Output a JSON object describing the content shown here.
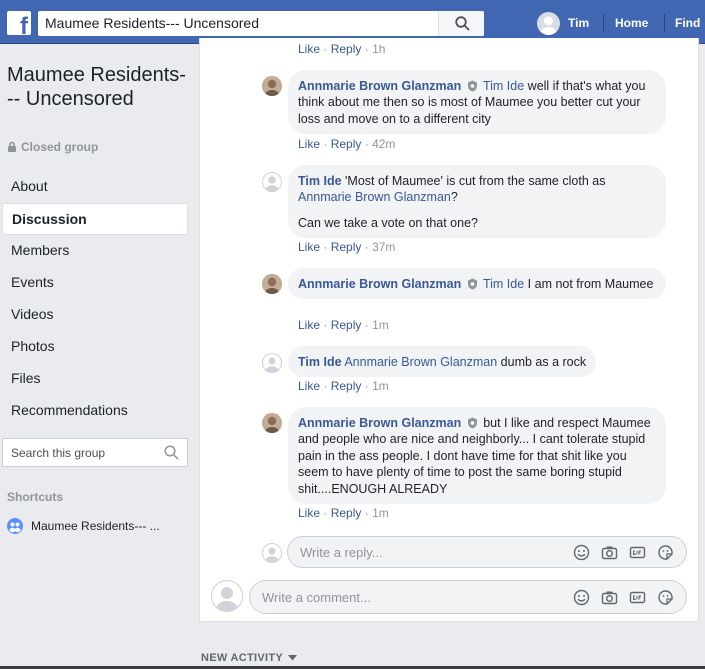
{
  "topbar": {
    "search_value": "Maumee Residents--- Uncensored",
    "user_name": "Tim",
    "nav": [
      "Home",
      "Find"
    ],
    "accent": "#4267b2"
  },
  "group": {
    "title": "Maumee Residents--- Uncensored",
    "privacy": "Closed group",
    "nav": [
      "About",
      "Discussion",
      "Members",
      "Events",
      "Videos",
      "Photos",
      "Files",
      "Recommendations"
    ],
    "active_nav": "Discussion",
    "search_placeholder": "Search this group",
    "shortcuts_heading": "Shortcuts",
    "shortcut_item": "Maumee Residents--- ..."
  },
  "feed": {
    "top_actions": {
      "like": "Like",
      "reply": "Reply",
      "time": "1h"
    },
    "comments": [
      {
        "author": "Annmarie Brown Glanzman",
        "mention": "Tim Ide",
        "text": "well if that's what you think about me then so is most of Maumee you better cut your loss and move on to a different city",
        "like": "Like",
        "reply": "Reply",
        "time": "42m"
      },
      {
        "author": "Tim Ide",
        "text_before": "'Most of Maumee' is cut from the same cloth as",
        "mention": "Annmarie Brown Glanzman",
        "text_after": "?",
        "second_line": "Can we take a vote on that one?",
        "like": "Like",
        "reply": "Reply",
        "time": "37m"
      },
      {
        "author": "Annmarie Brown Glanzman",
        "mention": "Tim Ide",
        "text": "I am not from Maumee",
        "like": "Like",
        "reply": "Reply",
        "time": "1m"
      },
      {
        "author": "Tim Ide",
        "mention": "Annmarie Brown Glanzman",
        "text": "dumb as a rock",
        "like": "Like",
        "reply": "Reply",
        "time": "1m"
      },
      {
        "author": "Annmarie Brown Glanzman",
        "text": "but I like and respect Maumee and people who are nice and neighborly... I cant tolerate stupid pain in the ass people. I dont have time for that shit like you seem to have plenty of time to post the same boring stupid shit....ENOUGH ALREADY",
        "like": "Like",
        "reply": "Reply",
        "time": "1m"
      }
    ],
    "separator": "·",
    "reply_placeholder": "Write a reply...",
    "comment_placeholder": "Write a comment...",
    "new_activity": "NEW ACTIVITY"
  }
}
